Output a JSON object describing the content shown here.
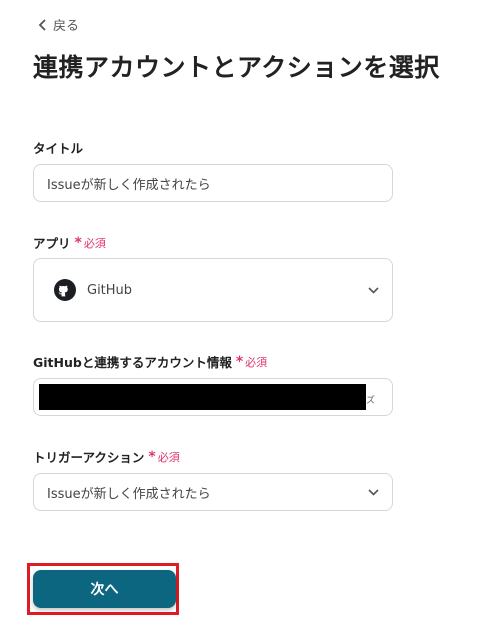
{
  "nav": {
    "back_label": "戻る"
  },
  "page": {
    "title": "連携アカウントとアクションを選択"
  },
  "required_text": "必須",
  "form": {
    "title_field": {
      "label": "タイトル",
      "value": "Issueが新しく作成されたら"
    },
    "app_field": {
      "label": "アプリ",
      "value": "GitHub",
      "icon": "github-icon"
    },
    "account_field": {
      "label": "GitHubと連携するアカウント情報",
      "tail_text": "ズ"
    },
    "trigger_field": {
      "label": "トリガーアクション",
      "value": "Issueが新しく作成されたら"
    }
  },
  "next_button": {
    "label": "次へ"
  },
  "colors": {
    "primary": "#0d6680",
    "required": "#e0356b",
    "highlight": "#e01b24"
  }
}
